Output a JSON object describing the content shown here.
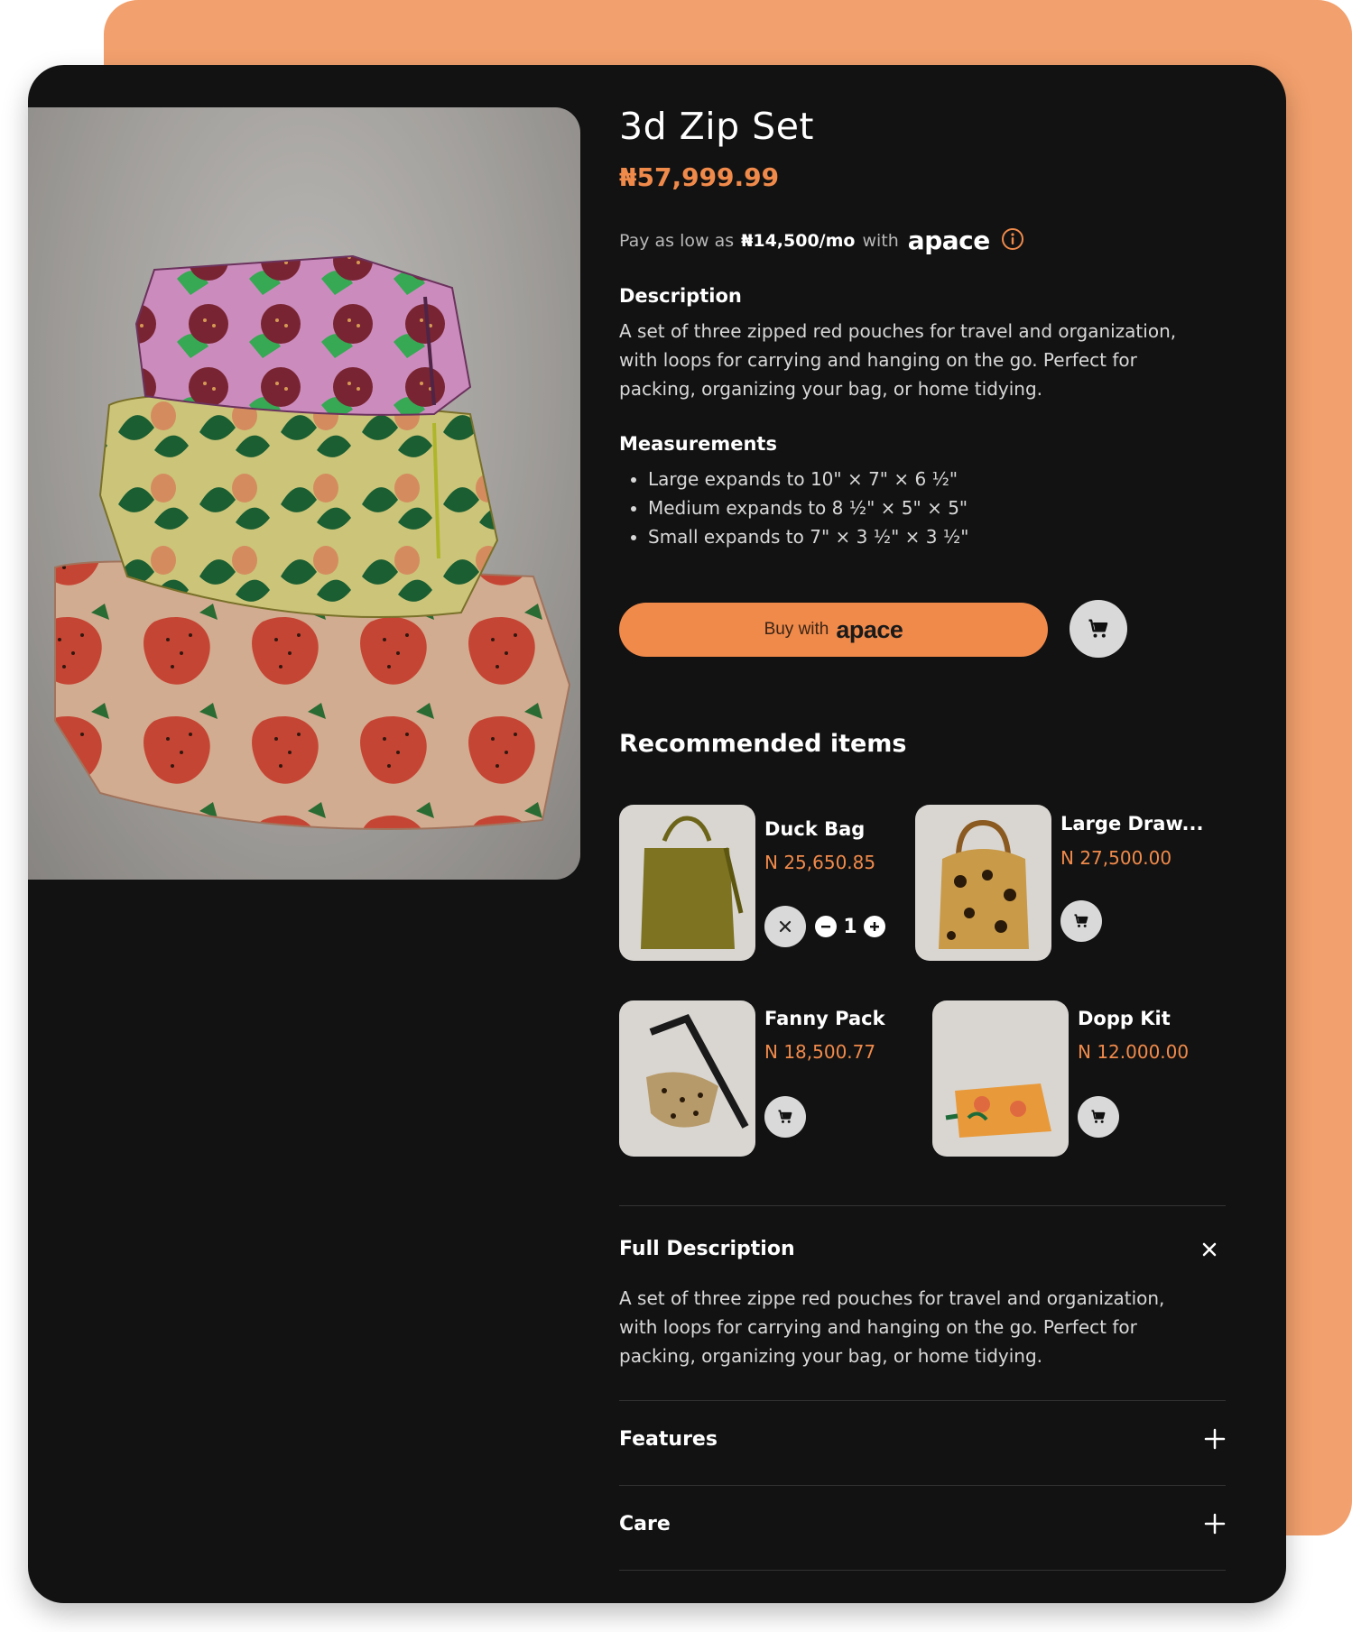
{
  "product": {
    "title": "3d Zip Set",
    "price": "₦57,999.99",
    "pay": {
      "prefix": "Pay as low as",
      "amount": "₦14,500/mo",
      "with": "with",
      "brand": "apace"
    },
    "description_label": "Description",
    "description": "A set of three zipped red pouches for travel and organization, with loops for carrying and hanging on the go. Perfect for packing, organizing your bag, or home tidying.",
    "measurements_label": "Measurements",
    "measurements": [
      "Large expands to 10\" × 7\" × 6 ½\"",
      "Medium expands to 8 ½\" × 5\" × 5\"",
      "Small expands to 7\" × 3 ½\" × 3 ½\""
    ],
    "buy_label": "Buy with",
    "buy_brand": "apace"
  },
  "recommended": {
    "title": "Recommended items",
    "items": [
      {
        "name": "Duck Bag",
        "price": "N 25,650.85",
        "qty": "1"
      },
      {
        "name": "Large Draw...",
        "price": "N 27,500.00"
      },
      {
        "name": "Fanny Pack",
        "price": "N 18,500.77"
      },
      {
        "name": "Dopp Kit",
        "price": "N 12.000.00"
      }
    ]
  },
  "accordion": {
    "full_description_label": "Full Description",
    "full_description": "A set of three zippe red pouches for travel and organization, with loops for carrying and hanging on the go. Perfect for packing, organizing your bag, or home tidying.",
    "features_label": "Features",
    "care_label": "Care"
  },
  "colors": {
    "accent": "#f08a4b",
    "backdrop": "#f2a06d",
    "card": "#121212"
  }
}
